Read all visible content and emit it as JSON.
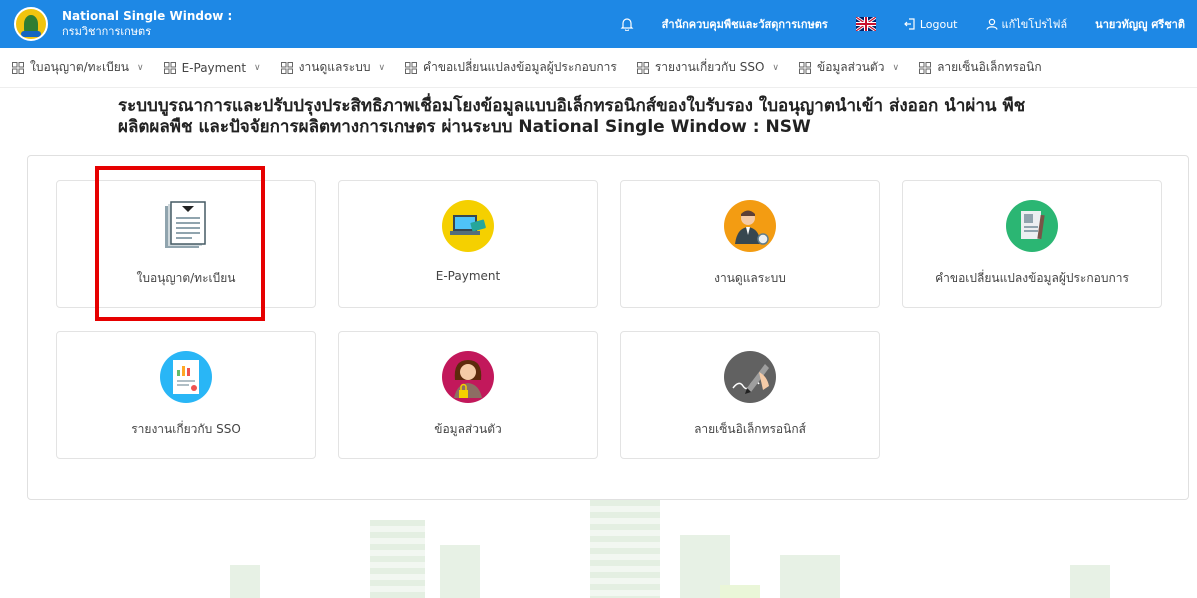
{
  "header": {
    "title": "National Single Window :",
    "subtitle": "กรมวิชาการเกษตร",
    "org_link": "สำนักควบคุมพืชและวัสดุการเกษตร",
    "logout_label": "Logout",
    "profile_label": "แก้ไขโปรไฟล์",
    "user_name": "นายวทัญญู ศรีชาติ",
    "background_color": "#1e88e5"
  },
  "menu": {
    "items": [
      {
        "label": "ใบอนุญาต/ทะเบียน",
        "has_dropdown": true
      },
      {
        "label": "E-Payment",
        "has_dropdown": true
      },
      {
        "label": "งานดูแลระบบ",
        "has_dropdown": true
      },
      {
        "label": "คำขอเปลี่ยนแปลงข้อมูลผู้ประกอบการ",
        "has_dropdown": false
      },
      {
        "label": "รายงานเกี่ยวกับ SSO",
        "has_dropdown": true
      },
      {
        "label": "ข้อมูลส่วนตัว",
        "has_dropdown": true
      },
      {
        "label": "ลายเซ็นอิเล็กทรอนิก",
        "has_dropdown": false
      }
    ]
  },
  "page": {
    "title_line1": "ระบบบูรณาการและปรับปรุงประสิทธิภาพเชื่อมโยงข้อมูลแบบอิเล็กทรอนิกส์ของใบรับรอง ใบอนุญาตนำเข้า ส่งออก นำผ่าน พืช",
    "title_line2": "ผลิตผลพืช และปัจจัยการผลิตทางการเกษตร ผ่านระบบ National Single Window : NSW"
  },
  "tiles": [
    {
      "label": "ใบอนุญาต/ทะเบียน",
      "icon": "license-document-icon"
    },
    {
      "label": "E-Payment",
      "icon": "epayment-laptop-icon"
    },
    {
      "label": "งานดูแลระบบ",
      "icon": "admin-user-icon"
    },
    {
      "label": "คำขอเปลี่ยนแปลงข้อมูลผู้ประกอบการ",
      "icon": "change-request-icon"
    },
    {
      "label": "รายงานเกี่ยวกับ SSO",
      "icon": "report-chart-icon"
    },
    {
      "label": "ข้อมูลส่วนตัว",
      "icon": "personal-info-icon"
    },
    {
      "label": "ลายเซ็นอิเล็กทรอนิกส์",
      "icon": "e-signature-icon"
    }
  ],
  "colors": {
    "highlight": "#e60000",
    "accent": "#1e88e5"
  }
}
